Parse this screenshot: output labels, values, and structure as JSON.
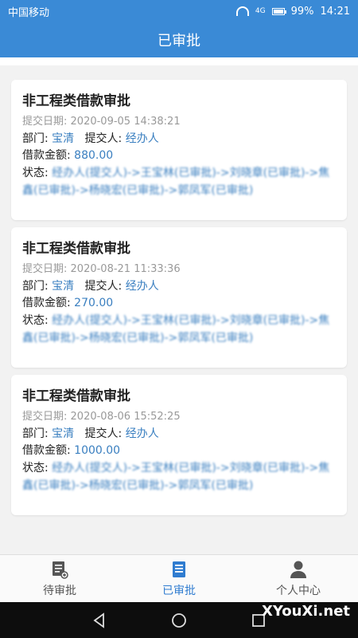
{
  "status_bar": {
    "carrier": "中国移动",
    "network": "4G",
    "battery": "99%",
    "time": "14:21"
  },
  "header": {
    "title": "已审批"
  },
  "labels": {
    "date_label": "提交日期:",
    "dept_label": "部门:",
    "submitter_label": "提交人:",
    "amount_label": "借款金额:",
    "status_label": "状态:"
  },
  "cards": [
    {
      "title": "非工程类借款审批",
      "date": "2020-09-05 14:38:21",
      "dept": "宝清",
      "submitter": "经办人",
      "amount": "880.00",
      "status_parts": [
        "经办人(提交人)->王宝林(已审批)->刘晓章(已审批)->焦鑫(已审批)->杨晓宏(已审批)->郭凤军(已审批)"
      ]
    },
    {
      "title": "非工程类借款审批",
      "date": "2020-08-21 11:33:36",
      "dept": "宝清",
      "submitter": "经办人",
      "amount": "270.00",
      "status_parts": [
        "经办人(提交人)->王宝林(已审批)->刘晓章(已审批)->焦鑫(已审批)->杨晓宏(已审批)->郭凤军(已审批)"
      ]
    },
    {
      "title": "非工程类借款审批",
      "date": "2020-08-06 15:52:25",
      "dept": "宝清",
      "submitter": "经办人",
      "amount": "1000.00",
      "status_parts": [
        "经办人(提交人)->王宝林(已审批)->刘晓章(已审批)->焦鑫(已审批)->杨晓宏(已审批)->郭凤军(已审批)"
      ]
    }
  ],
  "tabs": [
    {
      "label": "待审批",
      "icon": "pending-doc-icon",
      "active": false
    },
    {
      "label": "已审批",
      "icon": "approved-doc-icon",
      "active": true
    },
    {
      "label": "个人中心",
      "icon": "person-icon",
      "active": false
    }
  ],
  "watermark": "XYouXi.net",
  "colors": {
    "primary": "#3a8ad6",
    "link": "#3a7fc0",
    "background": "#f2f2f2"
  }
}
